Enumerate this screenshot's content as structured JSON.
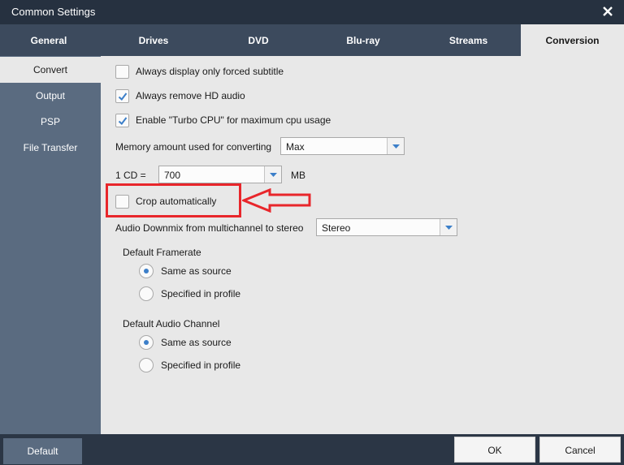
{
  "window": {
    "title": "Common Settings"
  },
  "tabs": [
    {
      "label": "General"
    },
    {
      "label": "Drives"
    },
    {
      "label": "DVD"
    },
    {
      "label": "Blu-ray"
    },
    {
      "label": "Streams"
    },
    {
      "label": "Conversion",
      "active": true
    }
  ],
  "sidebar": {
    "items": [
      {
        "label": "Convert",
        "active": true
      },
      {
        "label": "Output"
      },
      {
        "label": "PSP"
      },
      {
        "label": "File Transfer"
      }
    ]
  },
  "settings": {
    "forced_subtitle": {
      "label": "Always display only forced subtitle",
      "checked": false
    },
    "remove_hd_audio": {
      "label": "Always remove HD audio",
      "checked": true
    },
    "turbo_cpu": {
      "label": "Enable \"Turbo CPU\" for maximum cpu usage",
      "checked": true
    },
    "memory": {
      "label": "Memory amount used for converting",
      "value": "Max"
    },
    "cd_size": {
      "label": "1 CD =",
      "value": "700",
      "unit": "MB"
    },
    "crop": {
      "label": "Crop automatically",
      "checked": false
    },
    "downmix": {
      "label": "Audio Downmix from multichannel to stereo",
      "value": "Stereo"
    },
    "framerate": {
      "label": "Default Framerate",
      "options": [
        {
          "label": "Same as source",
          "checked": true
        },
        {
          "label": "Specified in profile",
          "checked": false
        }
      ]
    },
    "audio_channel": {
      "label": "Default Audio Channel",
      "options": [
        {
          "label": "Same as source",
          "checked": true
        },
        {
          "label": "Specified in profile",
          "checked": false
        }
      ]
    }
  },
  "annotation": {
    "highlight_color": "#e8262b"
  },
  "buttons": {
    "default": "Default",
    "ok": "OK",
    "cancel": "Cancel"
  },
  "colors": {
    "titlebar": "#263140",
    "tabbar": "#3c4a5d",
    "sidebar": "#5a6b80",
    "content": "#e8e8e8",
    "accent": "#3c7fc9"
  }
}
